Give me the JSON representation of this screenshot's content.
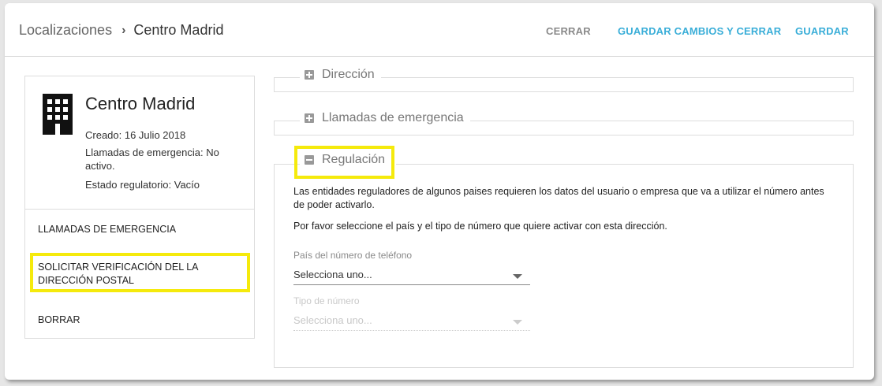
{
  "header": {
    "breadcrumb_root": "Localizaciones",
    "breadcrumb_separator": "›",
    "breadcrumb_current": "Centro Madrid",
    "actions": {
      "close": "CERRAR",
      "save_close": "GUARDAR CAMBIOS Y CERRAR",
      "save": "GUARDAR"
    }
  },
  "location_card": {
    "icon": "building-icon",
    "name": "Centro Madrid",
    "created": "Creado: 16 Julio 2018",
    "emergency_status": "Llamadas de emergencia: No activo.",
    "regulatory_status": "Estado regulatorio: Vacío",
    "menu": [
      "LLAMADAS DE EMERGENCIA",
      "SOLICITAR VERIFICACIÓN DEL LA DIRECCIÓN POSTAL",
      "BORRAR"
    ]
  },
  "sections": {
    "address": {
      "title": "Dirección",
      "icon": "plus-icon"
    },
    "emergency": {
      "title": "Llamadas de emergencia",
      "icon": "plus-icon"
    },
    "regulation": {
      "title": "Regulación",
      "icon": "minus-icon",
      "text1": "Las entidades reguladores de algunos paises requieren los datos del usuario o empresa que va a utilizar el número antes de poder activarlo.",
      "text2": "Por favor seleccione el país y el tipo de número que quiere activar con esta dirección.",
      "country_label": "País del número de teléfono",
      "country_value": "Selecciona uno...",
      "type_label": "Tipo de número",
      "type_value": "Selecciona uno..."
    }
  },
  "colors": {
    "accent": "#3aaed8",
    "highlight": "#f5ea0c",
    "muted": "#8a8a8a"
  }
}
